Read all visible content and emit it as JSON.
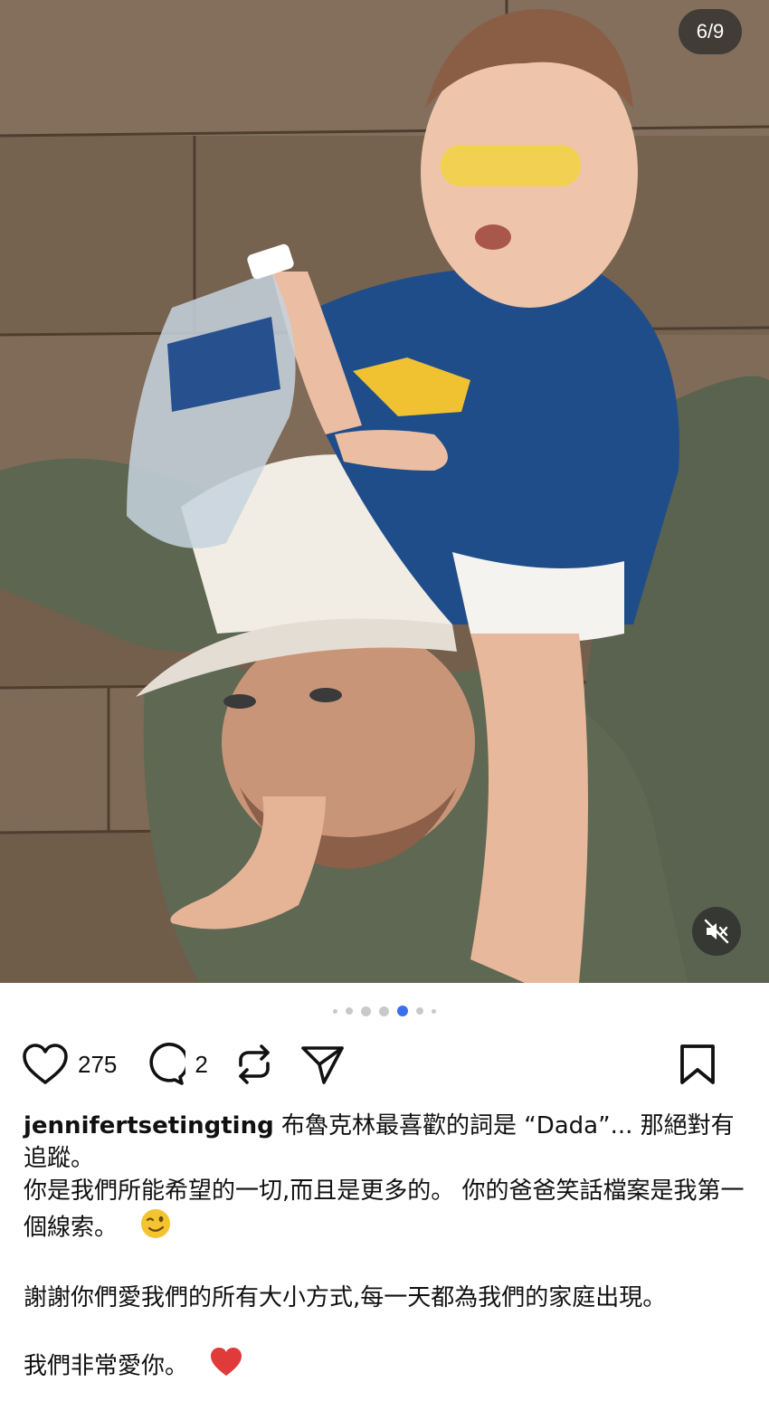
{
  "media": {
    "counter": "6/9",
    "mute_icon": "speaker-muted-icon"
  },
  "carousel": {
    "active_index": 4,
    "count": 7
  },
  "actions": {
    "like_count": "275",
    "comment_count": "2",
    "icons": [
      "heart-icon",
      "comment-icon",
      "repost-icon",
      "send-icon",
      "bookmark-icon"
    ]
  },
  "caption": {
    "username": "jennifertsetingting",
    "line1": "布魯克林最喜歡的詞是 “Dada”... 那絕對有追蹤。",
    "line2": "你是我們所能希望的一切,而且是更多的。 你的爸爸笑話檔案是我第一個線索。",
    "line3": "謝謝你們愛我們的所有大小方式,每一天都為我們的家庭出現。",
    "line4": "我們非常愛你。"
  },
  "colors": {
    "active_dot": "#3b6ff0",
    "heart_emoji": "#e03a3a",
    "wink_emoji": "#f4c430"
  }
}
